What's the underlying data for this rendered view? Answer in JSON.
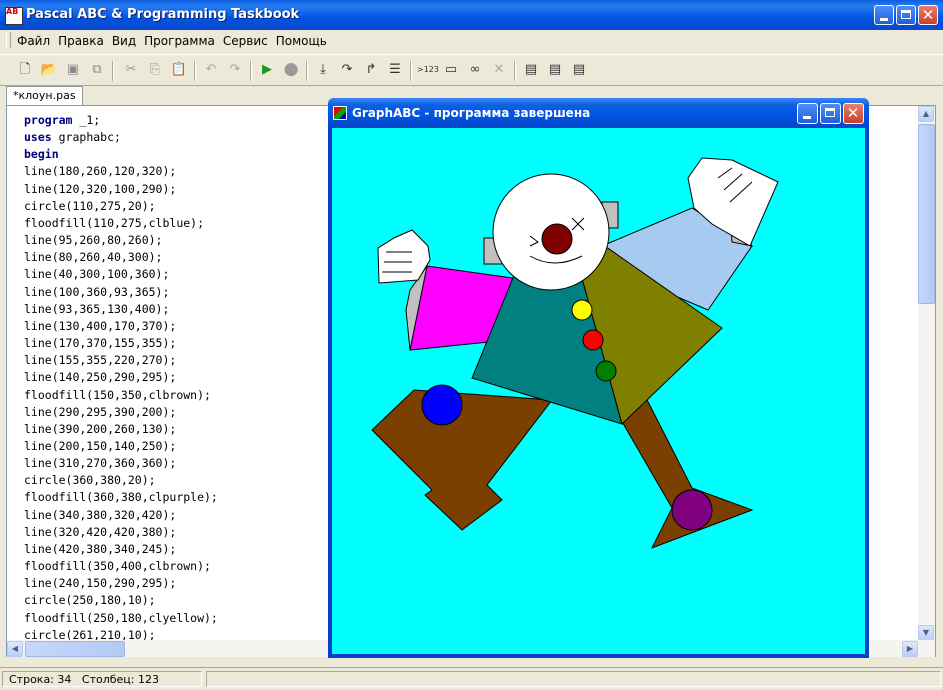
{
  "app": {
    "title": "Pascal ABC & Programming Taskbook",
    "icon_label": "AB"
  },
  "menu": [
    "Файл",
    "Правка",
    "Вид",
    "Программа",
    "Сервис",
    "Помощь"
  ],
  "toolbar": {
    "icons": [
      "new-file-icon",
      "open-folder-icon",
      "save-icon",
      "save-all-icon",
      "cut-icon",
      "copy-icon",
      "paste-icon",
      "undo-icon",
      "redo-icon",
      "run-icon",
      "stop-icon",
      "step-into-icon",
      "step-over-icon",
      "step-out-icon",
      "watch-icon",
      "output-number-icon",
      "window-icon",
      "glasses-icon",
      "close-x-icon",
      "taskbook-1-icon",
      "taskbook-2-icon",
      "taskbook-3-icon"
    ],
    "output_label": ">123"
  },
  "tab": {
    "label": "*клоун.pas"
  },
  "code": {
    "lines": [
      "program _1;",
      "uses graphabc;",
      "begin",
      "line(180,260,120,320);",
      "line(120,320,100,290);",
      "circle(110,275,20);",
      "floodfill(110,275,clblue);",
      "line(95,260,80,260);",
      "line(80,260,40,300);",
      "line(40,300,100,360);",
      "line(100,360,93,365);",
      "line(93,365,130,400);",
      "line(130,400,170,370);",
      "line(170,370,155,355);",
      "line(155,355,220,270);",
      "line(140,250,290,295);",
      "floodfill(150,350,clbrown);",
      "line(290,295,390,200);",
      "line(390,200,260,130);",
      "line(200,150,140,250);",
      "line(310,270,360,360);",
      "circle(360,380,20);",
      "floodfill(360,380,clpurple);",
      "line(340,380,320,420);",
      "line(320,420,420,380);",
      "line(420,380,340,245);",
      "floodfill(350,400,clbrown);",
      "line(240,150,290,295);",
      "circle(250,180,10);",
      "floodfill(250,180,clyellow);",
      "circle(261,210,10);"
    ]
  },
  "graph_window": {
    "title": "GraphABC - программа завершена"
  },
  "status": {
    "row": "Строка: 34",
    "col": "Столбец: 123"
  },
  "colors": {
    "canvas": "#00ffff",
    "brown": "#7b3f00",
    "teal": "#008080",
    "olive": "#808000",
    "magenta": "#ff00ff",
    "lightblue": "#a6caf0",
    "blue": "#0000ff",
    "purple": "#800080",
    "maroon": "#800000",
    "yellow": "#ffff00",
    "red": "#ff0000",
    "green": "#008000",
    "gray": "#c0c0c0"
  }
}
